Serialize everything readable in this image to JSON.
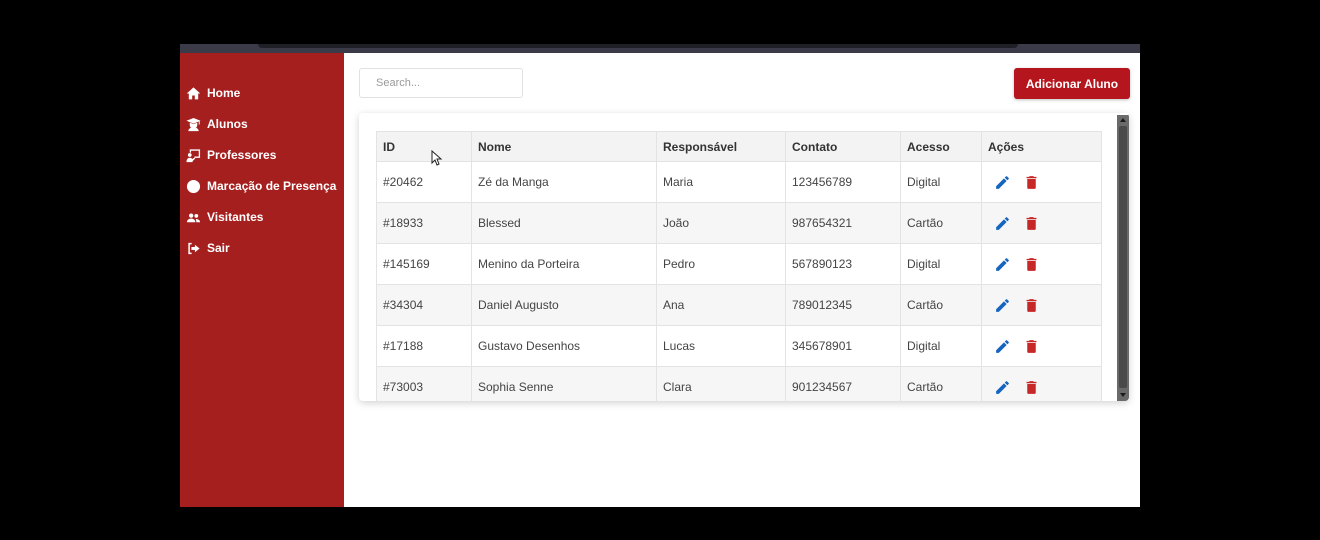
{
  "sidebar": {
    "items": [
      {
        "label": "Home",
        "icon": "home-icon"
      },
      {
        "label": "Alunos",
        "icon": "student-icon"
      },
      {
        "label": "Professores",
        "icon": "teacher-icon"
      },
      {
        "label": "Marcação de Presença",
        "icon": "clock-icon"
      },
      {
        "label": "Visitantes",
        "icon": "users-icon"
      },
      {
        "label": "Sair",
        "icon": "sign-out-icon"
      }
    ]
  },
  "toolbar": {
    "search_placeholder": "Search...",
    "add_label": "Adicionar Aluno"
  },
  "table": {
    "columns": [
      "ID",
      "Nome",
      "Responsável",
      "Contato",
      "Acesso",
      "Ações"
    ],
    "rows": [
      {
        "id": "#20462",
        "nome": "Zé da Manga",
        "responsavel": "Maria",
        "contato": "123456789",
        "acesso": "Digital"
      },
      {
        "id": "#18933",
        "nome": "Blessed",
        "responsavel": "João",
        "contato": "987654321",
        "acesso": "Cartão"
      },
      {
        "id": "#145169",
        "nome": "Menino da Porteira",
        "responsavel": "Pedro",
        "contato": "567890123",
        "acesso": "Digital"
      },
      {
        "id": "#34304",
        "nome": "Daniel Augusto",
        "responsavel": "Ana",
        "contato": "789012345",
        "acesso": "Cartão"
      },
      {
        "id": "#17188",
        "nome": "Gustavo Desenhos",
        "responsavel": "Lucas",
        "contato": "345678901",
        "acesso": "Digital"
      },
      {
        "id": "#73003",
        "nome": "Sophia Senne",
        "responsavel": "Clara",
        "contato": "901234567",
        "acesso": "Cartão"
      }
    ]
  },
  "colors": {
    "sidebar": "#a51f1f",
    "accent": "#b5151d",
    "edit_icon": "#1565c0",
    "delete_icon": "#c62828"
  }
}
